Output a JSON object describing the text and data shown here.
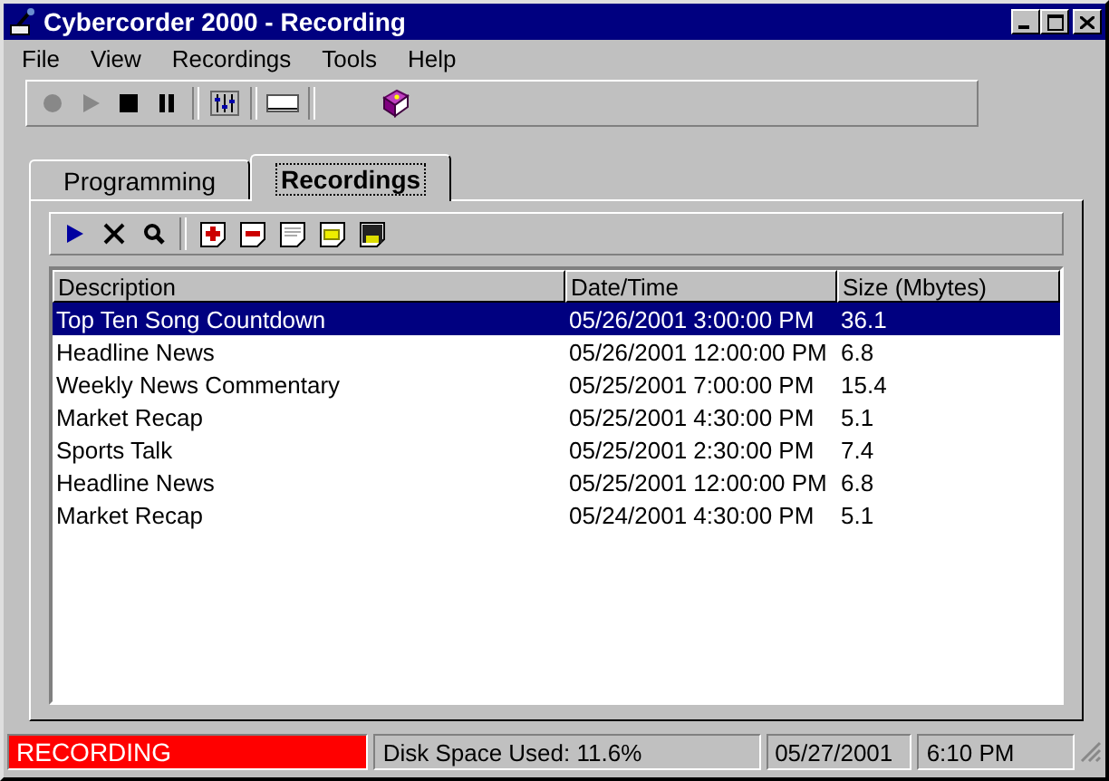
{
  "window": {
    "title": "Cybercorder 2000 - Recording"
  },
  "menu": [
    "File",
    "View",
    "Recordings",
    "Tools",
    "Help"
  ],
  "toolbar": [
    {
      "kind": "record",
      "disabled": true
    },
    {
      "kind": "play",
      "disabled": true
    },
    {
      "kind": "stop",
      "disabled": false
    },
    {
      "kind": "pause",
      "disabled": false
    },
    {
      "kind": "sep"
    },
    {
      "kind": "mixer"
    },
    {
      "kind": "sep"
    },
    {
      "kind": "display"
    },
    {
      "kind": "sep"
    },
    {
      "kind": "help"
    }
  ],
  "tabs": [
    {
      "label": "Programming",
      "selected": false
    },
    {
      "label": "Recordings",
      "selected": true
    }
  ],
  "tab_toolbar": [
    {
      "kind": "play"
    },
    {
      "kind": "delete"
    },
    {
      "kind": "search"
    },
    {
      "kind": "sep"
    },
    {
      "kind": "add"
    },
    {
      "kind": "remove"
    },
    {
      "kind": "note"
    },
    {
      "kind": "notes"
    },
    {
      "kind": "save"
    }
  ],
  "table": {
    "columns": [
      "Description",
      "Date/Time",
      "Size (Mbytes)"
    ],
    "rows": [
      {
        "cells": [
          "Top Ten Song Countdown",
          "05/26/2001 3:00:00 PM",
          "36.1"
        ],
        "selected": true
      },
      {
        "cells": [
          "Headline News",
          "05/26/2001 12:00:00 PM",
          "6.8"
        ],
        "selected": false
      },
      {
        "cells": [
          "Weekly News Commentary",
          "05/25/2001 7:00:00 PM",
          "15.4"
        ],
        "selected": false
      },
      {
        "cells": [
          "Market Recap",
          "05/25/2001 4:30:00 PM",
          "5.1"
        ],
        "selected": false
      },
      {
        "cells": [
          "Sports Talk",
          "05/25/2001 2:30:00 PM",
          "7.4"
        ],
        "selected": false
      },
      {
        "cells": [
          "Headline News",
          "05/25/2001 12:00:00 PM",
          "6.8"
        ],
        "selected": false
      },
      {
        "cells": [
          "Market Recap",
          "05/24/2001 4:30:00 PM",
          "5.1"
        ],
        "selected": false
      }
    ]
  },
  "status_bar": {
    "state": "RECORDING",
    "disk": "Disk Space Used: 11.6%",
    "date": "05/27/2001",
    "time": "6:10 PM"
  }
}
